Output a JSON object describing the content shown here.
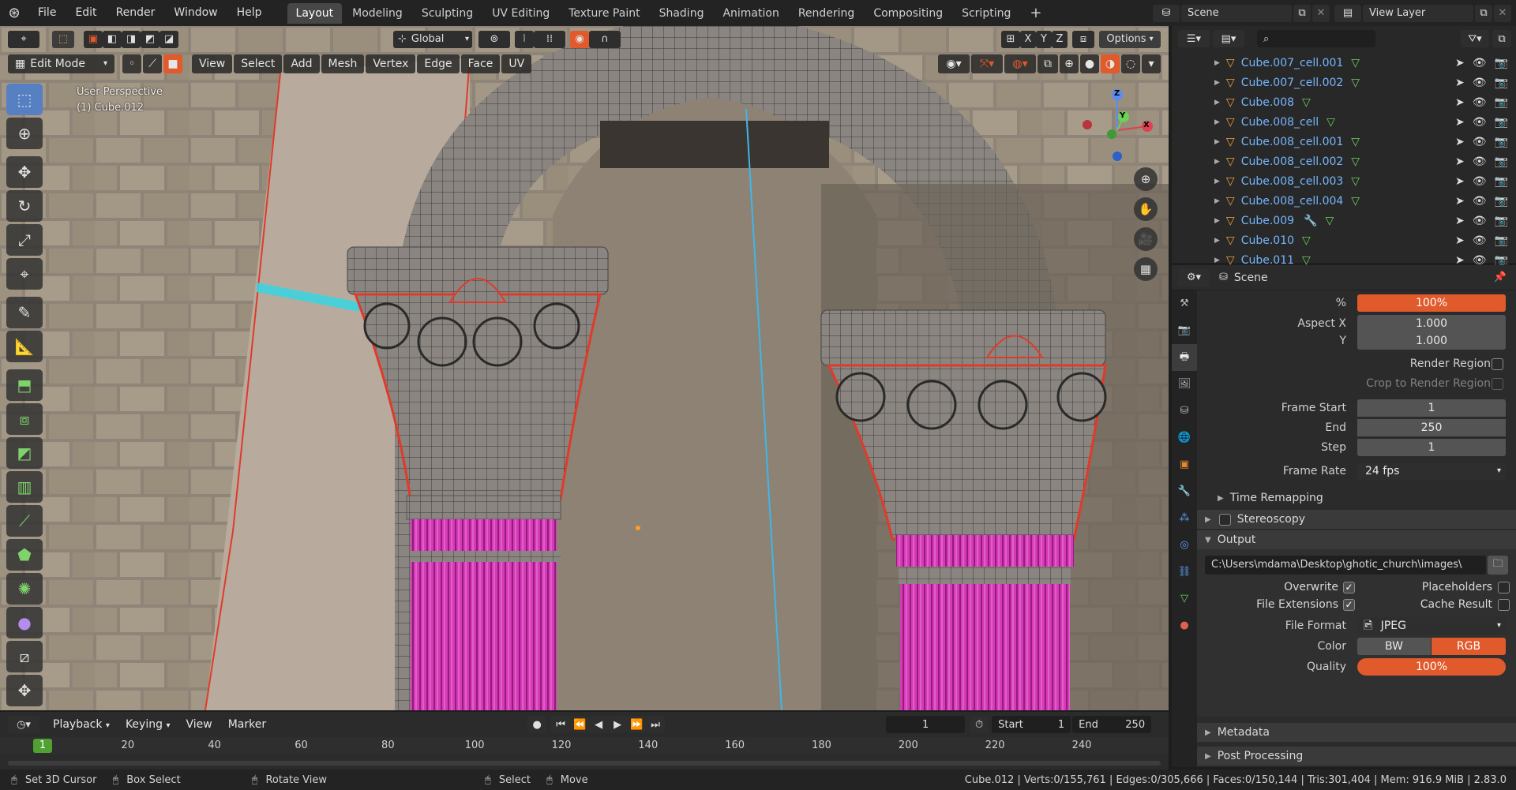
{
  "app": {
    "menus": [
      "File",
      "Edit",
      "Render",
      "Window",
      "Help"
    ],
    "workspaces": [
      "Layout",
      "Modeling",
      "Sculpting",
      "UV Editing",
      "Texture Paint",
      "Shading",
      "Animation",
      "Rendering",
      "Compositing",
      "Scripting"
    ],
    "active_workspace": "Layout",
    "add_workspace": "+",
    "scene_label": "Scene",
    "view_layer_label": "View Layer"
  },
  "viewport": {
    "transform_orientation": "Global",
    "options_label": "Options",
    "axis_x": "X",
    "axis_y": "Y",
    "axis_z": "Z",
    "mode": "Edit Mode",
    "menus": [
      "View",
      "Select",
      "Add",
      "Mesh",
      "Vertex",
      "Edge",
      "Face",
      "UV"
    ],
    "overlay_line1": "User Perspective",
    "overlay_line2": "(1) Cube.012",
    "gizmo_x": "X",
    "gizmo_y": "Y",
    "gizmo_z": "Z",
    "mesh_color": "#c2185b",
    "accent_orange": "#e05a2b"
  },
  "outliner": {
    "search_placeholder": "",
    "items": [
      {
        "name": "Cube.007_cell.001",
        "has_modifier": false
      },
      {
        "name": "Cube.007_cell.002",
        "has_modifier": false
      },
      {
        "name": "Cube.008",
        "has_modifier": false
      },
      {
        "name": "Cube.008_cell",
        "has_modifier": false
      },
      {
        "name": "Cube.008_cell.001",
        "has_modifier": false
      },
      {
        "name": "Cube.008_cell.002",
        "has_modifier": false
      },
      {
        "name": "Cube.008_cell.003",
        "has_modifier": false
      },
      {
        "name": "Cube.008_cell.004",
        "has_modifier": false
      },
      {
        "name": "Cube.009",
        "has_modifier": true
      },
      {
        "name": "Cube.010",
        "has_modifier": false
      },
      {
        "name": "Cube.011",
        "has_modifier": false
      }
    ]
  },
  "properties": {
    "context_label": "Scene",
    "resolution_pct_label": "%",
    "resolution_pct": "100%",
    "aspect_x_label": "Aspect X",
    "aspect_x": "1.000",
    "aspect_y_label": "Y",
    "aspect_y": "1.000",
    "render_region": "Render Region",
    "crop_region": "Crop to Render Region",
    "frame_start_label": "Frame Start",
    "frame_start": "1",
    "frame_end_label": "End",
    "frame_end": "250",
    "frame_step_label": "Step",
    "frame_step": "1",
    "frame_rate_label": "Frame Rate",
    "frame_rate": "24 fps",
    "time_remapping": "Time Remapping",
    "stereoscopy": "Stereoscopy",
    "output": "Output",
    "output_path": "C:\\Users\\mdama\\Desktop\\ghotic_church\\images\\",
    "overwrite": "Overwrite",
    "placeholders": "Placeholders",
    "file_extensions": "File Extensions",
    "cache_result": "Cache Result",
    "file_format_label": "File Format",
    "file_format": "JPEG",
    "color_label": "Color",
    "color_bw": "BW",
    "color_rgb": "RGB",
    "quality_label": "Quality",
    "quality": "100%",
    "metadata": "Metadata",
    "post_processing": "Post Processing"
  },
  "timeline": {
    "playback": "Playback",
    "keying": "Keying",
    "view": "View",
    "marker": "Marker",
    "current_frame": "1",
    "start_label": "Start",
    "start": "1",
    "end_label": "End",
    "end": "250",
    "ruler": [
      "20",
      "40",
      "60",
      "80",
      "100",
      "120",
      "140",
      "160",
      "180",
      "200",
      "220",
      "240"
    ],
    "playhead": "1"
  },
  "statusbar": {
    "set_cursor": "Set 3D Cursor",
    "box_select": "Box Select",
    "rotate_view": "Rotate View",
    "select": "Select",
    "move": "Move",
    "stats": "Cube.012 | Verts:0/155,761 | Edges:0/305,666 | Faces:0/150,144 | Tris:301,404 | Mem: 916.9 MiB | 2.83.0"
  }
}
